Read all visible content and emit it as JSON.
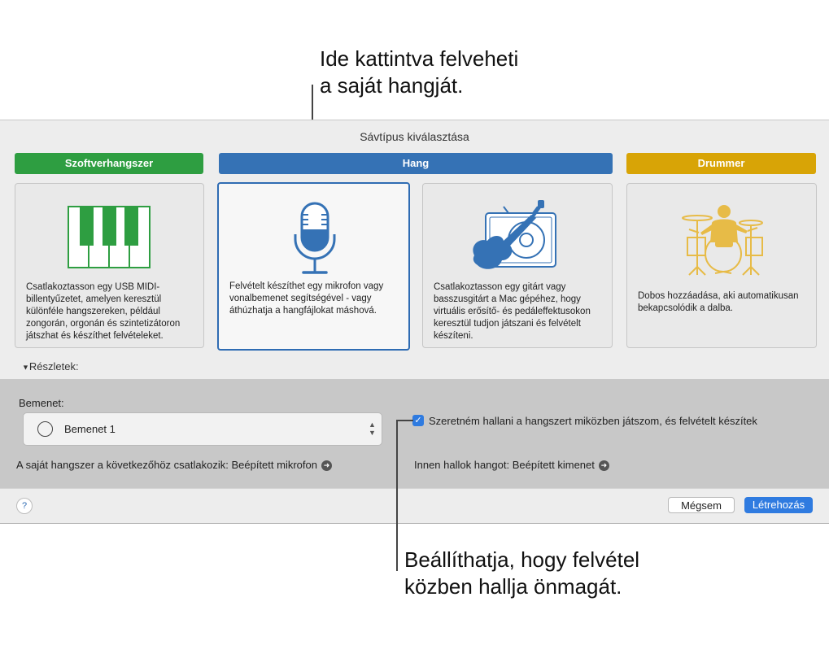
{
  "callouts": {
    "top": [
      "Ide kattintva felveheti",
      "a saját hangját."
    ],
    "bottom": [
      "Beállíthatja, hogy felvétel",
      "közben hallja önmagát."
    ]
  },
  "dialog": {
    "title": "Sávtípus kiválasztása",
    "tracks": [
      {
        "header": "Szoftverhangszer",
        "color": "#2e9e41",
        "description": "Csatlakoztasson egy USB MIDI-billentyűzetet, amelyen keresztül különféle hangszereken, például zongorán, orgonán és szintetizátoron játszhat és készíthet felvételeket.",
        "icon": "piano-keyboard-icon"
      },
      {
        "header": "Hang",
        "color": "#3572b5",
        "description": "Felvételt készíthet egy mikrofon vagy vonalbemenet segítségével - vagy áthúzhatja a hangfájlokat máshová.",
        "icon": "microphone-icon",
        "selected": true
      },
      {
        "description": "Csatlakoztasson egy gitárt vagy basszusgitárt a Mac gépéhez, hogy virtuális erősítő- és pedáleffektusokon keresztül tudjon játszani és felvételt készíteni.",
        "icon": "guitar-amp-icon"
      },
      {
        "header": "Drummer",
        "color": "#d8a406",
        "description": "Dobos hozzáadása, aki automatikusan bekapcsolódik a dalba.",
        "icon": "drummer-icon"
      }
    ],
    "details_label": "Részletek:",
    "input": {
      "label": "Bemenet:",
      "value": "Bemenet 1"
    },
    "monitoring_checkbox": {
      "checked": true,
      "label": "Szeretném hallani a hangszert miközben játszom, és felvételt készítek"
    },
    "connection_text": "A saját hangszer a következőhöz csatlakozik: Beépített mikrofon",
    "output_text": "Innen hallok hangot: Beépített kimenet",
    "help_label": "?",
    "cancel_label": "Mégsem",
    "create_label": "Létrehozás",
    "accent_color": "#2f7be0"
  }
}
